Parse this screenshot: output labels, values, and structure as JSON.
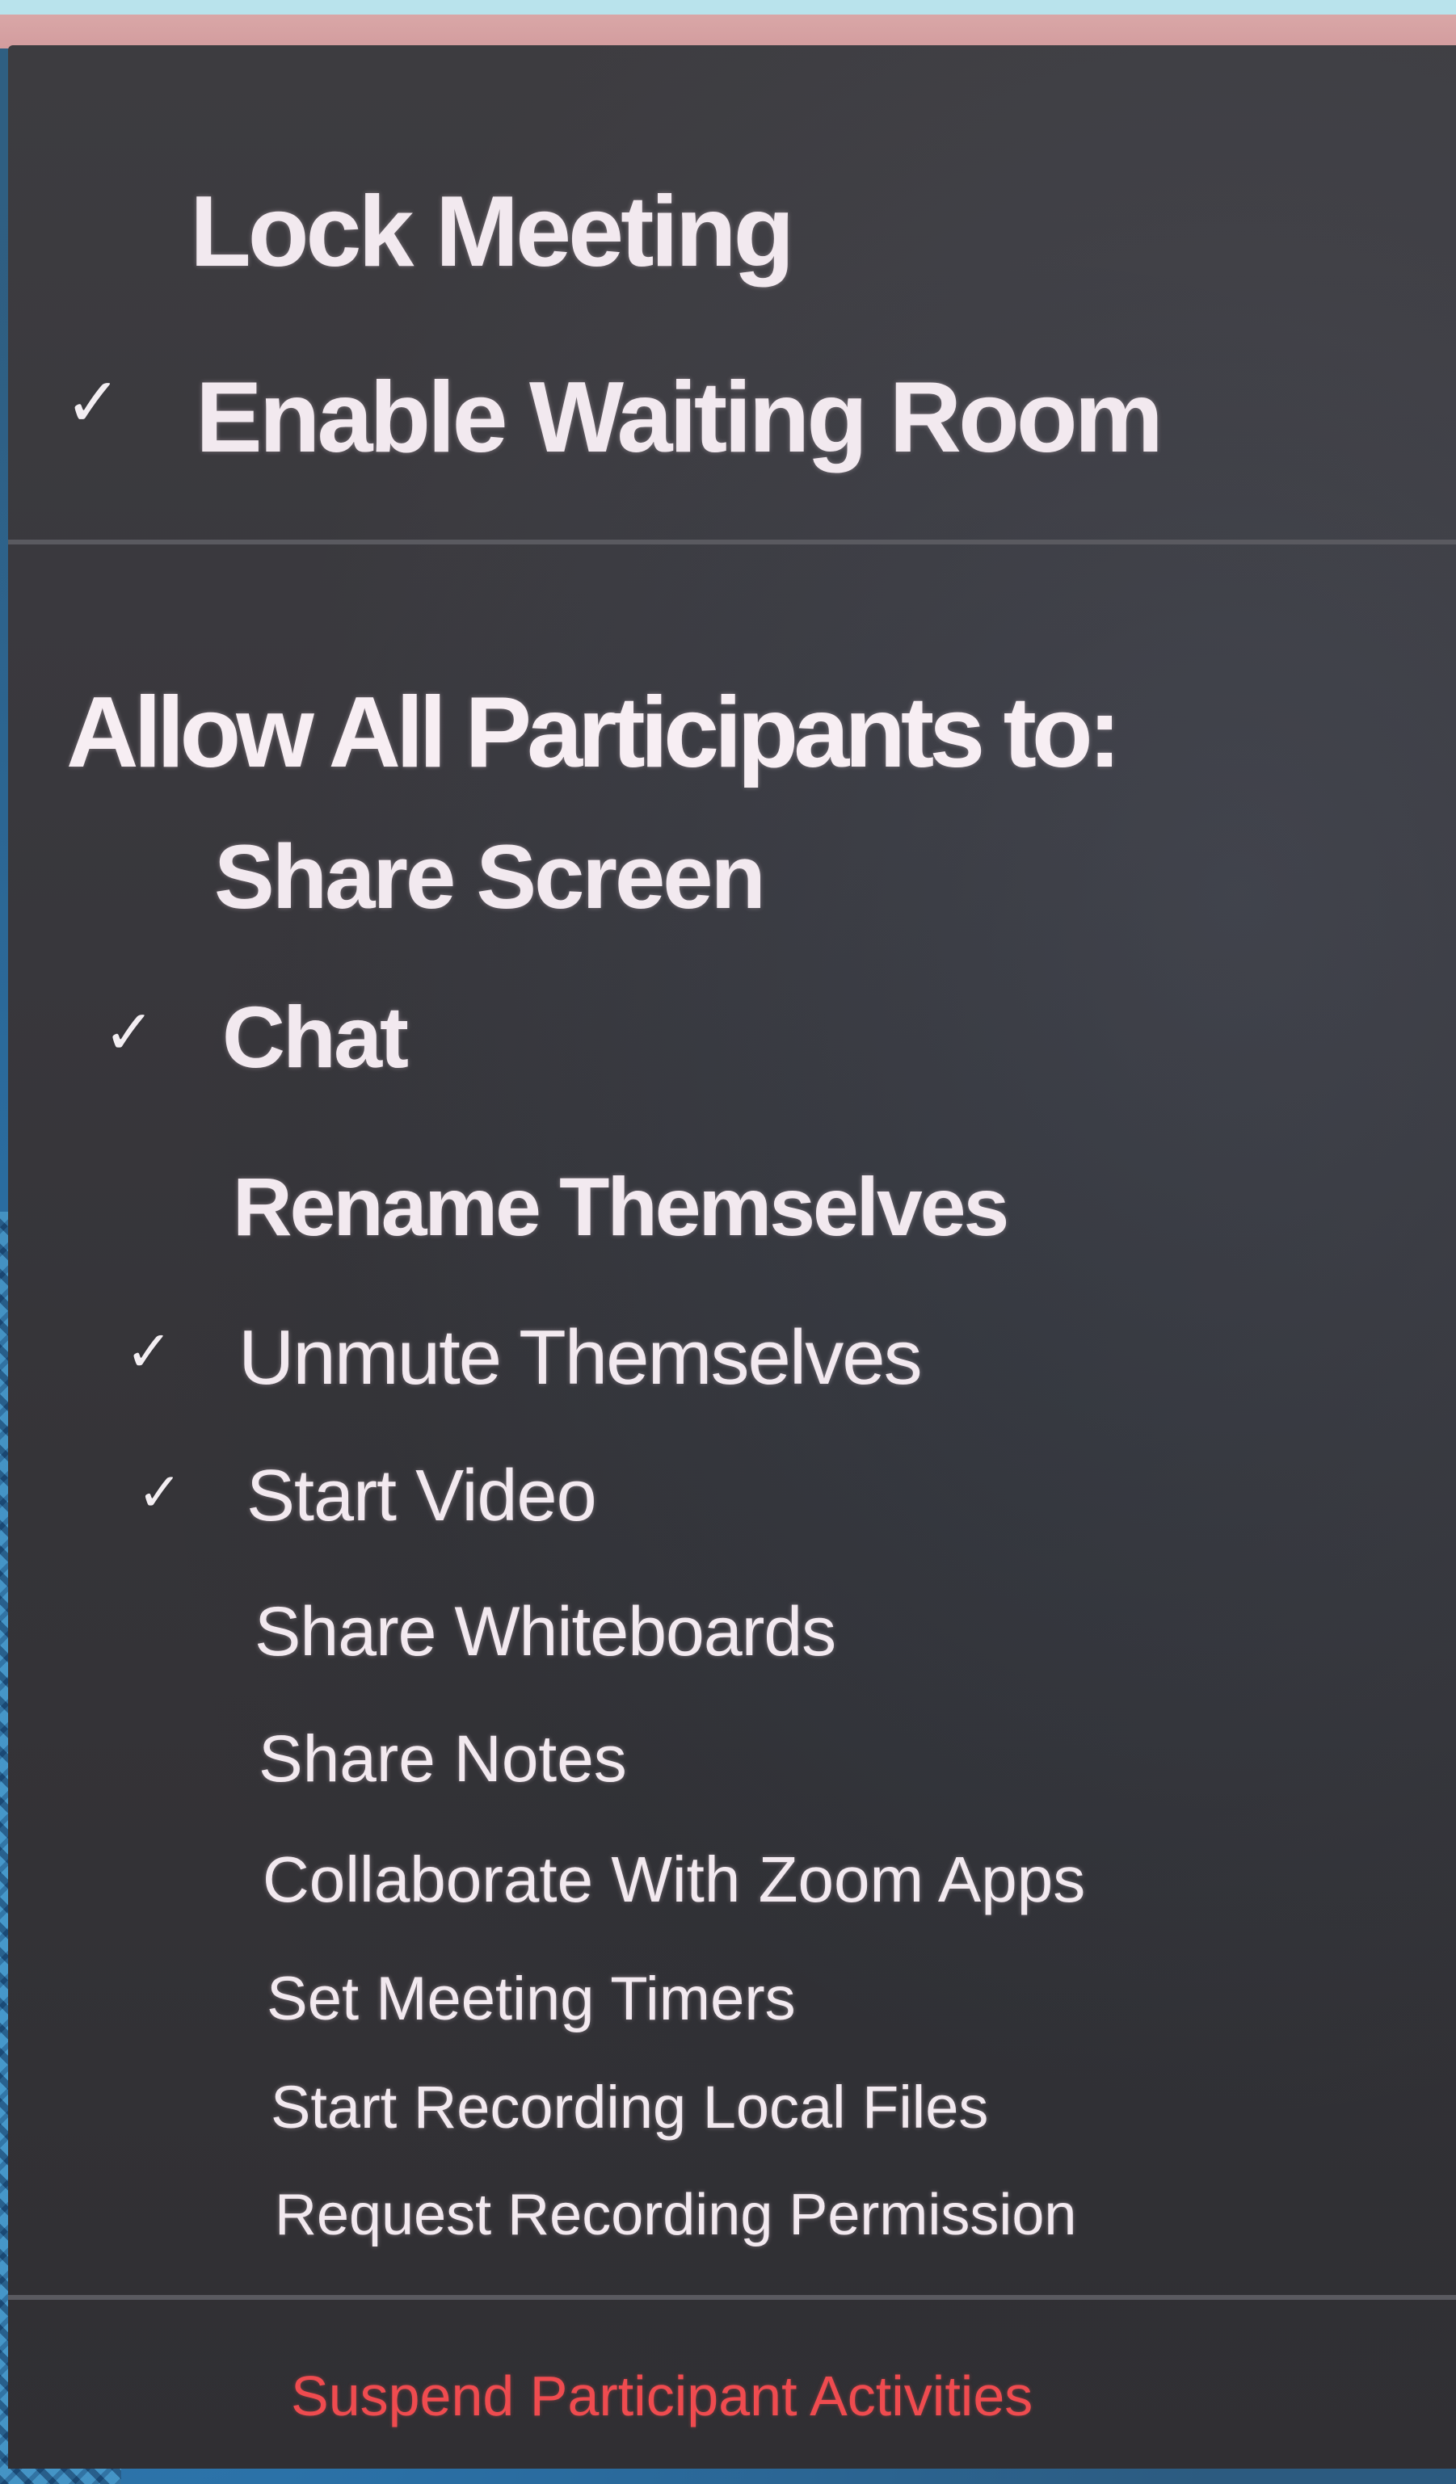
{
  "menu": {
    "lock_meeting": {
      "label": "Lock Meeting",
      "checked": false
    },
    "waiting_room": {
      "label": "Enable Waiting Room",
      "checked": true
    },
    "section_heading": "Allow All Participants to:",
    "options": [
      {
        "label": "Share Screen",
        "checked": false
      },
      {
        "label": "Chat",
        "checked": true
      },
      {
        "label": "Rename Themselves",
        "checked": false
      },
      {
        "label": "Unmute Themselves",
        "checked": true
      },
      {
        "label": "Start Video",
        "checked": true
      },
      {
        "label": "Share Whiteboards",
        "checked": false
      },
      {
        "label": "Share Notes",
        "checked": false
      },
      {
        "label": "Collaborate With Zoom Apps",
        "checked": false
      },
      {
        "label": "Set Meeting Timers",
        "checked": false
      },
      {
        "label": "Start Recording Local Files",
        "checked": false
      },
      {
        "label": "Request Recording Permission",
        "checked": false
      }
    ],
    "suspend": {
      "label": "Suspend Participant Activities"
    },
    "check_glyph": "✓",
    "colors": {
      "menu_background": "#39383d",
      "text": "#f2e9ef",
      "danger": "#ef4b4f",
      "divider": "#5a5a60"
    }
  }
}
